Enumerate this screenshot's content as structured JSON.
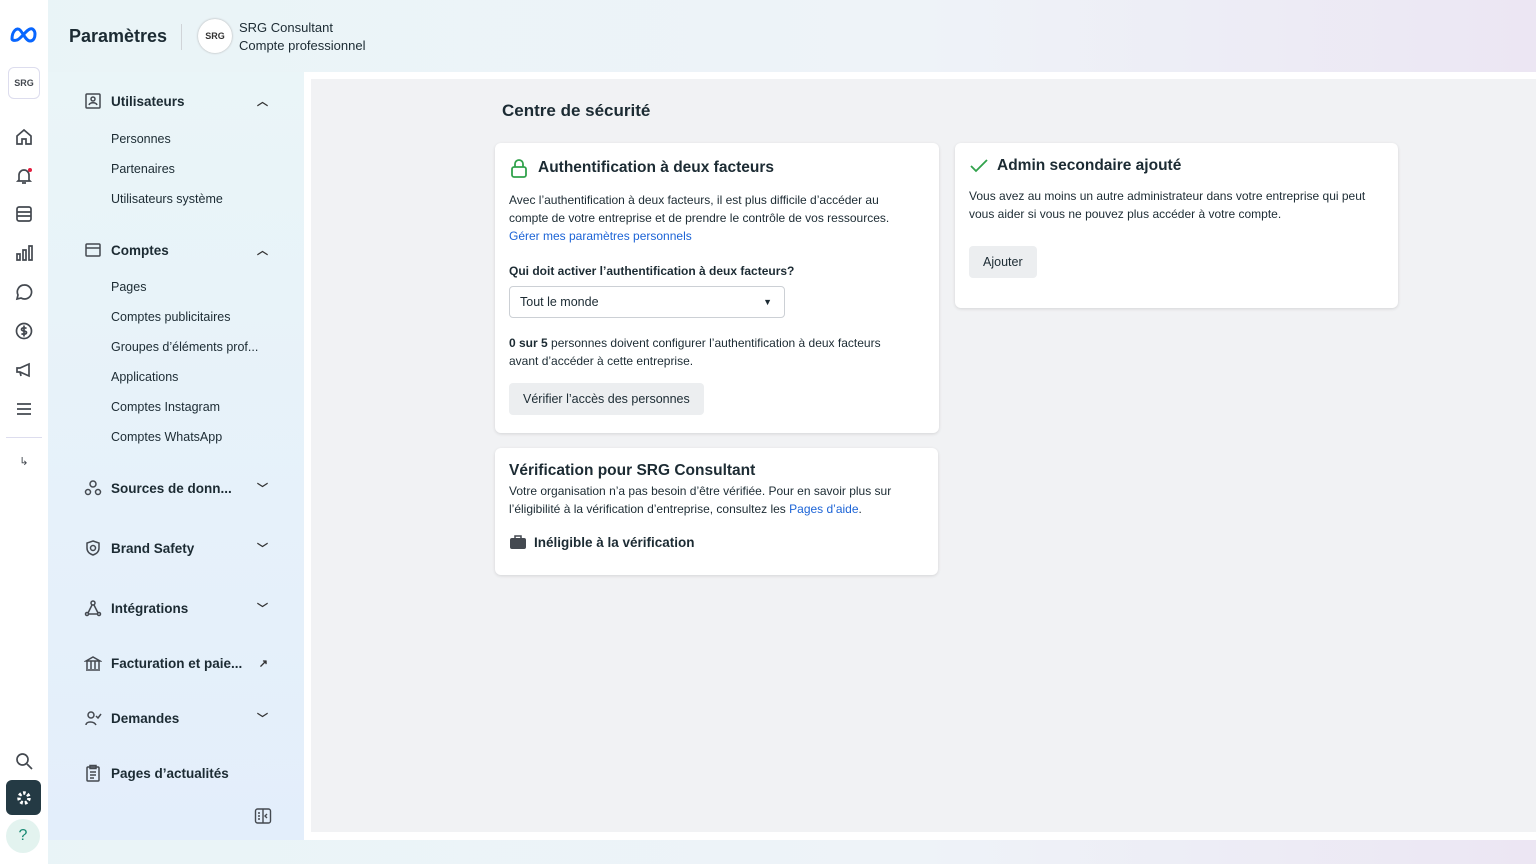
{
  "header": {
    "title": "Paramètres",
    "business_name": "SRG Consultant",
    "business_type": "Compte professionnel",
    "logo_text": "SRG"
  },
  "rail": {
    "icons": [
      "meta-logo",
      "business-avatar",
      "home-icon",
      "notifications-icon",
      "pages-icon",
      "insights-icon",
      "messages-icon",
      "billing-icon",
      "ads-icon",
      "menu-icon",
      "collapse-icon",
      "search-icon",
      "settings-icon",
      "help-icon"
    ],
    "help": "?",
    "collapse": "↳"
  },
  "sidebar": {
    "users": {
      "label": "Utilisateurs",
      "items": [
        "Personnes",
        "Partenaires",
        "Utilisateurs système"
      ]
    },
    "accounts": {
      "label": "Comptes",
      "items": [
        "Pages",
        "Comptes publicitaires",
        "Groupes d’éléments prof...",
        "Applications",
        "Comptes Instagram",
        "Comptes WhatsApp"
      ]
    },
    "data_sources": "Sources de donn...",
    "brand_safety": "Brand Safety",
    "integrations": "Intégrations",
    "billing": "Facturation et paie...",
    "requests": "Demandes",
    "news_pages": "Pages d’actualités"
  },
  "main": {
    "title": "Centre de sécurité",
    "two_factor": {
      "title": "Authentification à deux facteurs",
      "description": "Avec l’authentification à deux facteurs, il est plus difficile d’accéder au compte de votre entreprise et de prendre le contrôle de vos ressources.",
      "link": "Gérer mes paramètres personnels",
      "question": "Qui doit activer l’authentification à deux facteurs?",
      "select_value": "Tout le monde",
      "count_bold": "0 sur 5",
      "count_text": " personnes doivent configurer l’authentification à deux facteurs avant d’accéder à cette entreprise.",
      "button": "Vérifier l’accès des personnes",
      "accent": "#31a24c"
    },
    "secondary_admin": {
      "title": "Admin secondaire ajouté",
      "description": "Vous avez au moins un autre administrateur dans votre entreprise qui peut vous aider si vous ne pouvez plus accéder à votre compte.",
      "button": "Ajouter"
    },
    "verification": {
      "title": "Vérification pour SRG Consultant",
      "description": "Votre organisation n’a pas besoin d’être vérifiée. Pour en savoir plus sur l’éligibilité à la vérification d’entreprise, consultez les ",
      "link": "Pages d’aide",
      "period": ".",
      "status": "Inéligible à la vérification"
    }
  }
}
